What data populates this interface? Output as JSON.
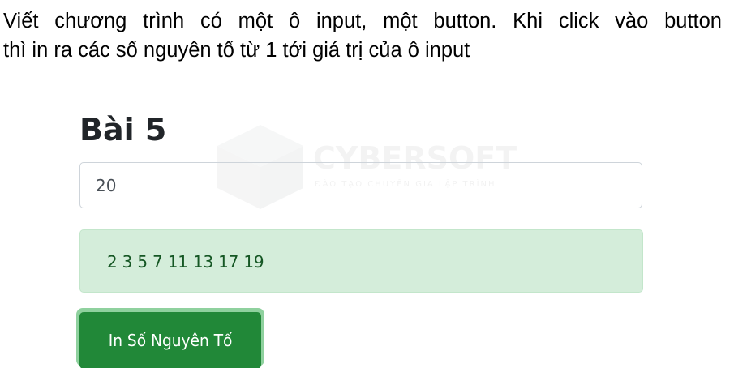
{
  "task": {
    "line1": "Viết chương trình có một ô input, một button. Khi click vào button",
    "line2": "thì in ra các số nguyên tố từ 1 tới giá trị của ô input"
  },
  "demo": {
    "heading": "Bài 5",
    "input_value": "20",
    "result": "2 3 5 7 11 13 17 19",
    "button_label": "In Số Nguyên Tố"
  },
  "watermark": {
    "brand": "CYBERSOFT",
    "tagline": "ĐÀO TẠO CHUYÊN GIA LẬP TRÌNH",
    "logo_icon": "cube-logo-icon"
  },
  "colors": {
    "alert_background": "#d4edda",
    "alert_text": "#155724",
    "button": "#218838",
    "button_focus_ring": "#8fd19e",
    "heading": "#212529"
  }
}
